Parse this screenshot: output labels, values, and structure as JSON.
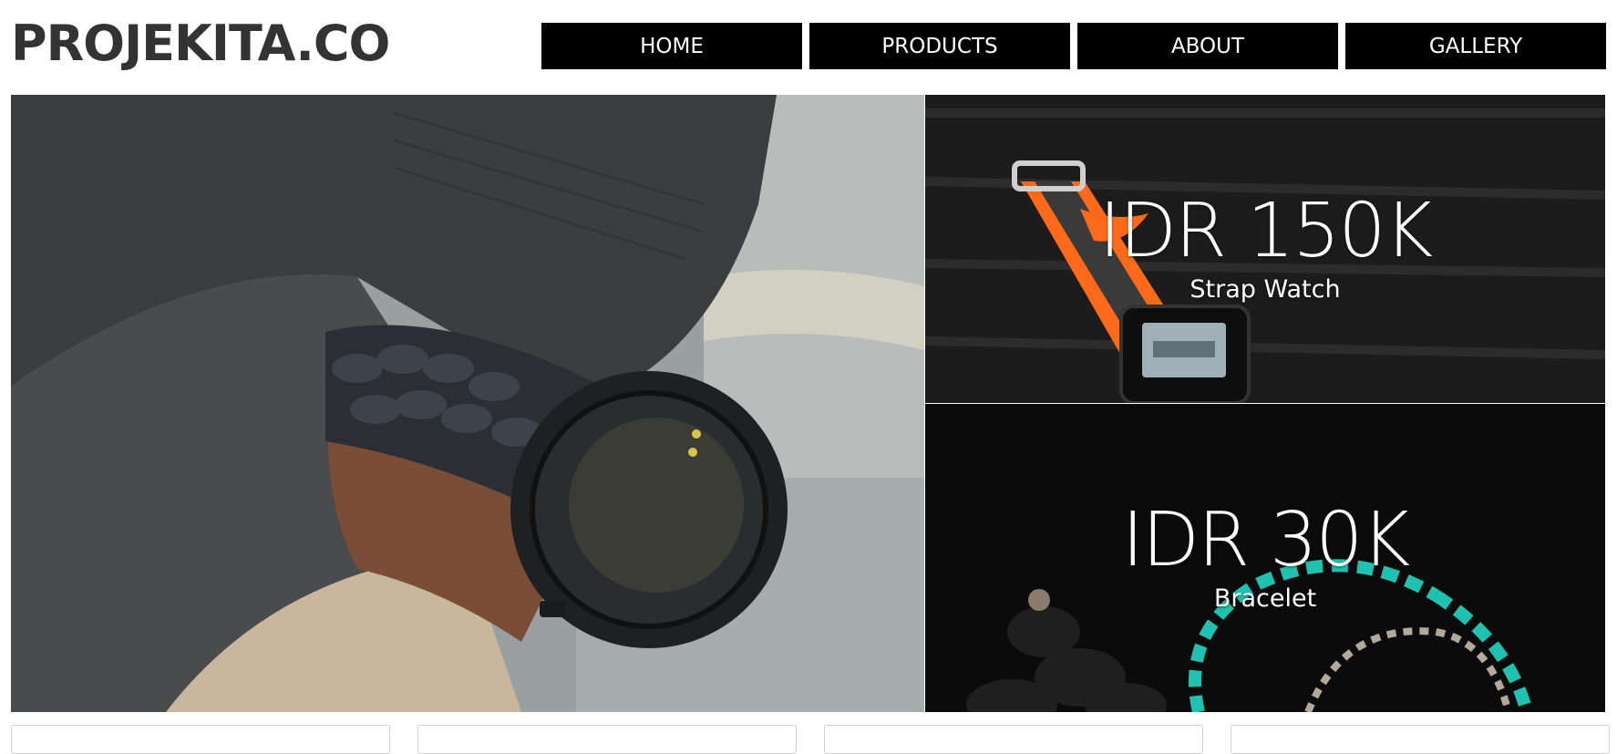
{
  "brand": {
    "logo": "PROJEKITA.CO"
  },
  "nav": {
    "items": [
      "HOME",
      "PRODUCTS",
      "ABOUT",
      "GALLERY"
    ]
  },
  "products": [
    {
      "price": "IDR 150K",
      "name": "Strap Watch"
    },
    {
      "price": "IDR 30K",
      "name": "Bracelet"
    }
  ]
}
